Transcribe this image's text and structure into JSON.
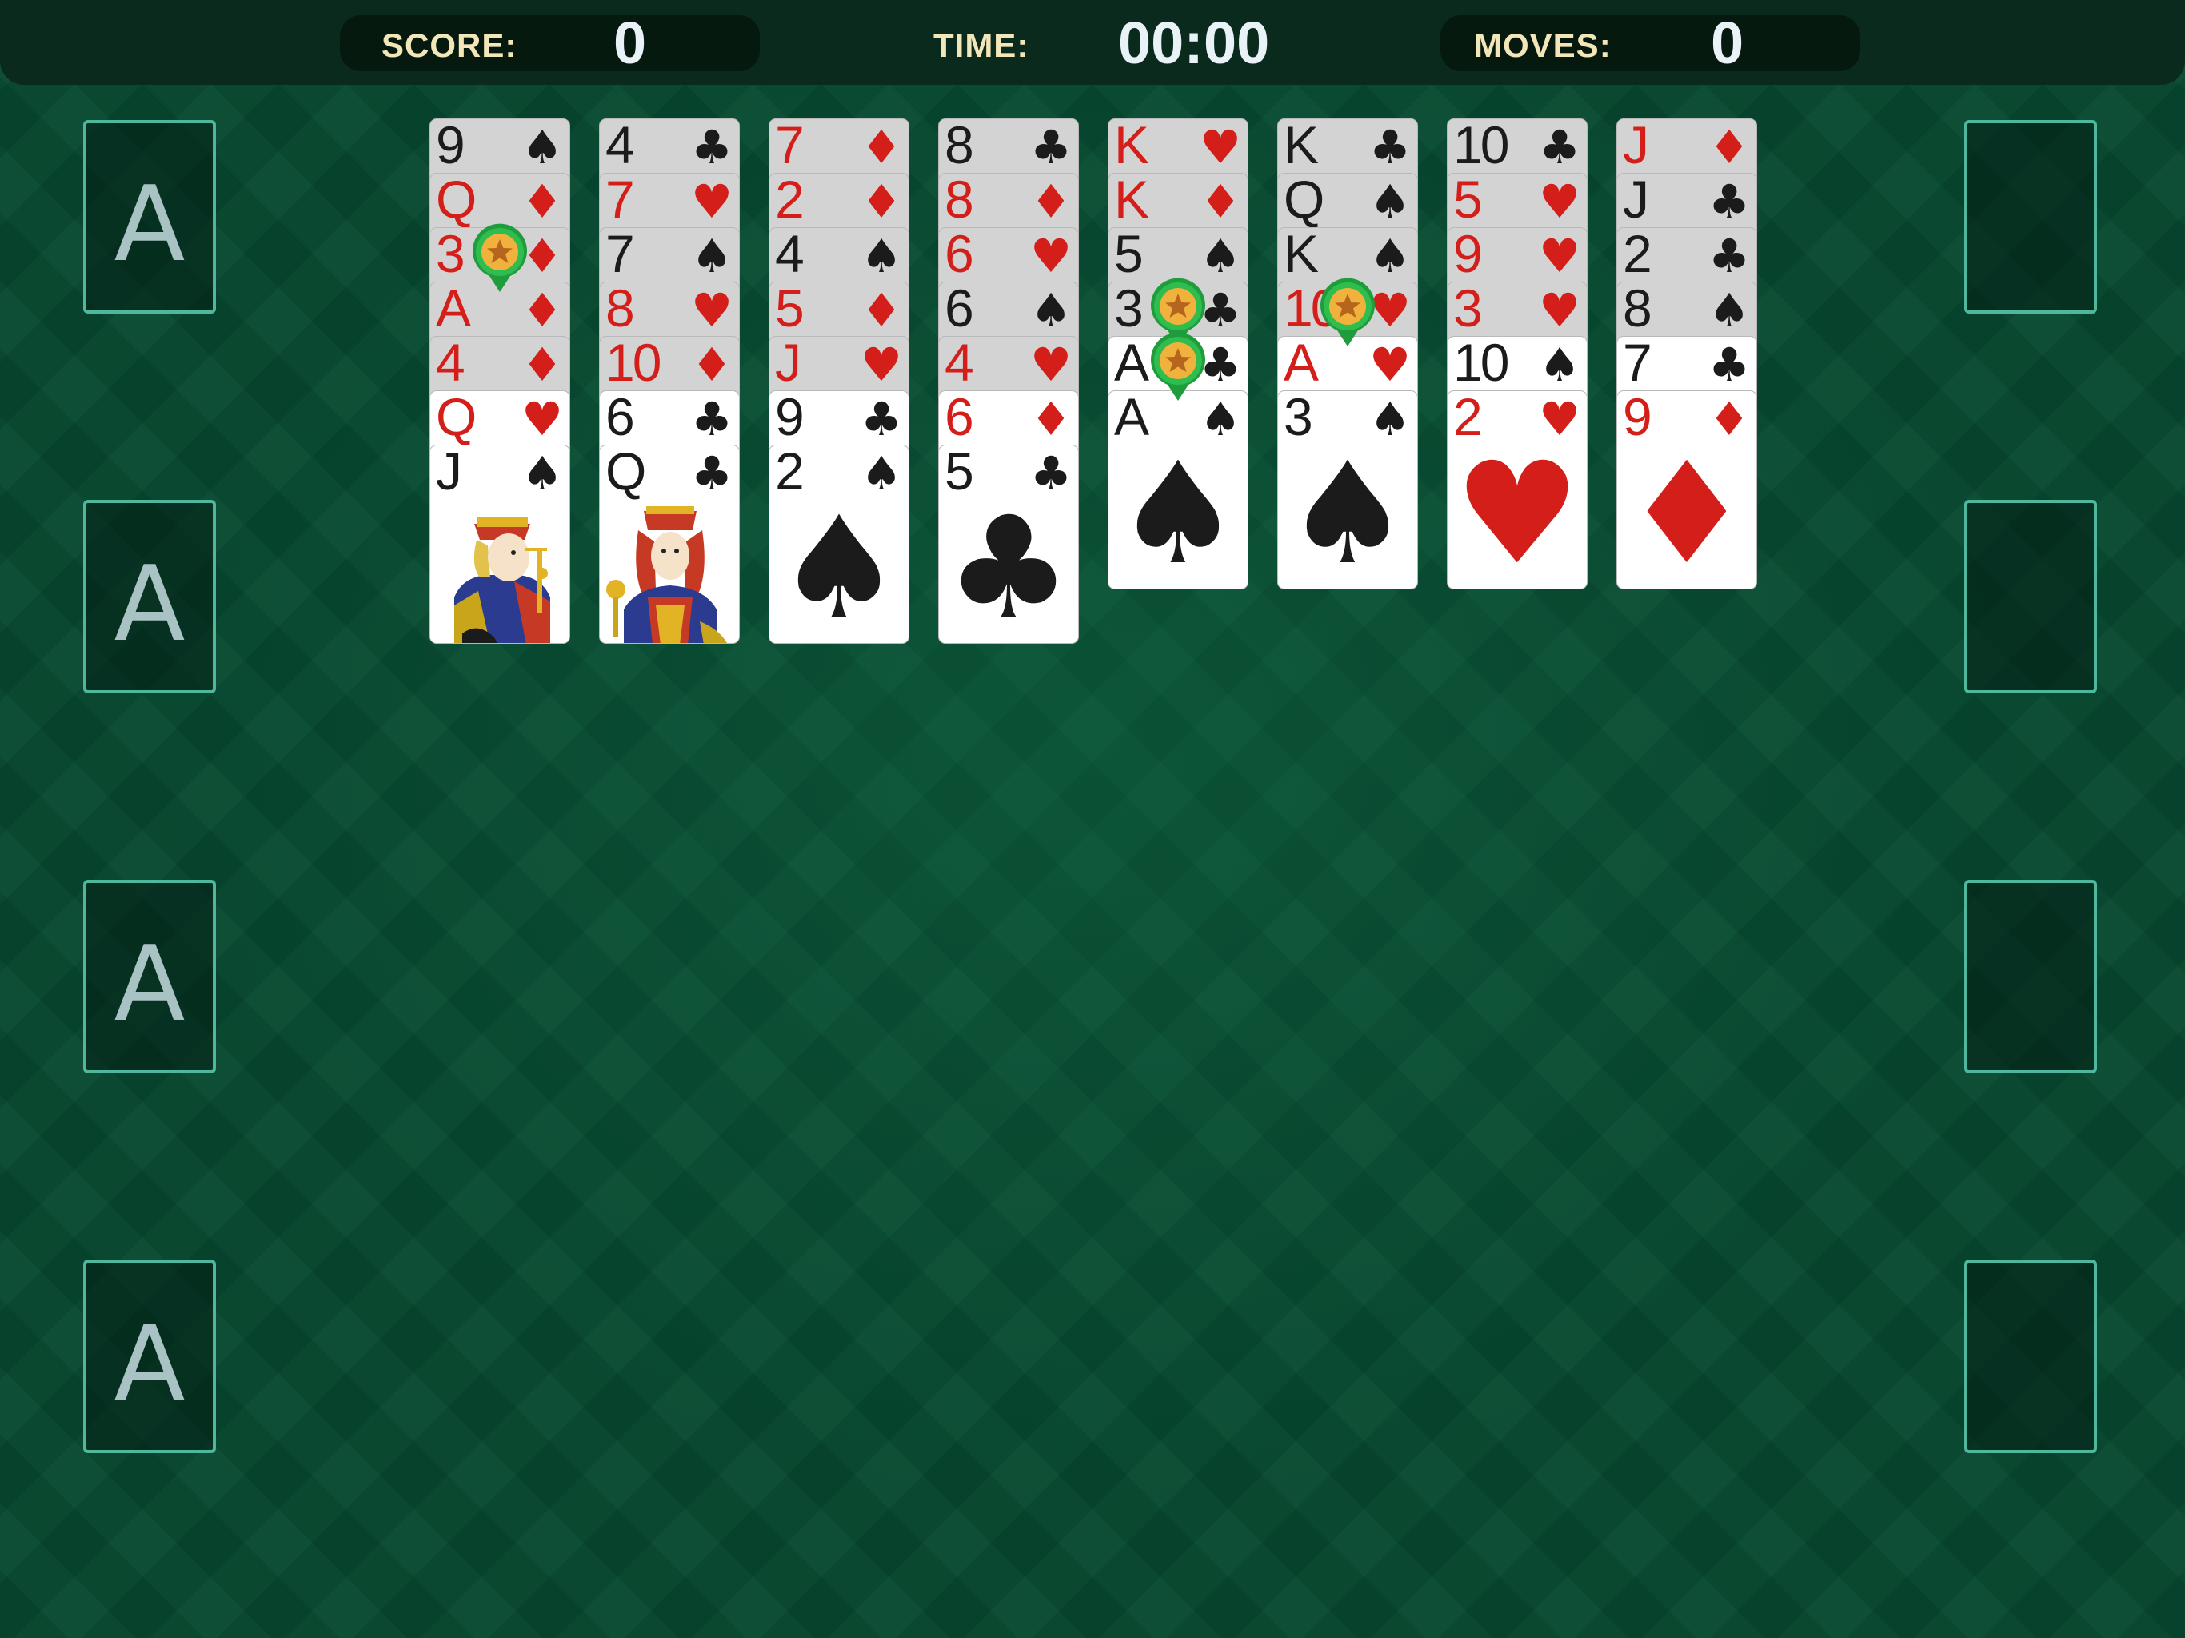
{
  "header": {
    "score_label": "SCORE:",
    "score_value": "0",
    "time_label": "TIME:",
    "time_value": "00:00",
    "moves_label": "MOVES:",
    "moves_value": "0"
  },
  "foundations": [
    {
      "label": "A"
    },
    {
      "label": "A"
    },
    {
      "label": "A"
    },
    {
      "label": "A"
    }
  ],
  "free_cells": [
    {
      "card": null
    },
    {
      "card": null
    },
    {
      "card": null
    },
    {
      "card": null
    }
  ],
  "colors": {
    "felt": "#064930",
    "header_bg": "#0b2a1e",
    "header_label": "#f3e6b8",
    "slot_border": "#4fb79c",
    "red_suit": "#d41e1a",
    "black_suit": "#1b1b1b",
    "badge_green": "#1f9d3c",
    "badge_gold": "#f0b23c"
  },
  "columns": [
    {
      "cards": [
        {
          "rank": "9",
          "suit": "♠",
          "color": "black"
        },
        {
          "rank": "Q",
          "suit": "♦",
          "color": "red"
        },
        {
          "rank": "3",
          "suit": "♦",
          "color": "red",
          "badge": "star-badge"
        },
        {
          "rank": "A",
          "suit": "♦",
          "color": "red"
        },
        {
          "rank": "4",
          "suit": "♦",
          "color": "red"
        },
        {
          "rank": "Q",
          "suit": "♥",
          "color": "red"
        },
        {
          "rank": "J",
          "suit": "♠",
          "color": "black",
          "face": "jack-portrait"
        }
      ]
    },
    {
      "cards": [
        {
          "rank": "4",
          "suit": "♣",
          "color": "black"
        },
        {
          "rank": "7",
          "suit": "♥",
          "color": "red"
        },
        {
          "rank": "7",
          "suit": "♠",
          "color": "black"
        },
        {
          "rank": "8",
          "suit": "♥",
          "color": "red"
        },
        {
          "rank": "10",
          "suit": "♦",
          "color": "red"
        },
        {
          "rank": "6",
          "suit": "♣",
          "color": "black"
        },
        {
          "rank": "Q",
          "suit": "♣",
          "color": "black",
          "face": "queen-portrait"
        }
      ]
    },
    {
      "cards": [
        {
          "rank": "7",
          "suit": "♦",
          "color": "red"
        },
        {
          "rank": "2",
          "suit": "♦",
          "color": "red"
        },
        {
          "rank": "4",
          "suit": "♠",
          "color": "black"
        },
        {
          "rank": "5",
          "suit": "♦",
          "color": "red"
        },
        {
          "rank": "J",
          "suit": "♥",
          "color": "red"
        },
        {
          "rank": "9",
          "suit": "♣",
          "color": "black"
        },
        {
          "rank": "2",
          "suit": "♠",
          "color": "black"
        }
      ]
    },
    {
      "cards": [
        {
          "rank": "8",
          "suit": "♣",
          "color": "black"
        },
        {
          "rank": "8",
          "suit": "♦",
          "color": "red"
        },
        {
          "rank": "6",
          "suit": "♥",
          "color": "red"
        },
        {
          "rank": "6",
          "suit": "♠",
          "color": "black"
        },
        {
          "rank": "4",
          "suit": "♥",
          "color": "red"
        },
        {
          "rank": "6",
          "suit": "♦",
          "color": "red"
        },
        {
          "rank": "5",
          "suit": "♣",
          "color": "black"
        }
      ]
    },
    {
      "cards": [
        {
          "rank": "K",
          "suit": "♥",
          "color": "red"
        },
        {
          "rank": "K",
          "suit": "♦",
          "color": "red"
        },
        {
          "rank": "5",
          "suit": "♠",
          "color": "black"
        },
        {
          "rank": "3",
          "suit": "♣",
          "color": "black",
          "badge": "star-badge"
        },
        {
          "rank": "A",
          "suit": "♣",
          "color": "black",
          "badge": "star-badge"
        },
        {
          "rank": "A",
          "suit": "♠",
          "color": "black"
        }
      ]
    },
    {
      "cards": [
        {
          "rank": "K",
          "suit": "♣",
          "color": "black"
        },
        {
          "rank": "Q",
          "suit": "♠",
          "color": "black"
        },
        {
          "rank": "K",
          "suit": "♠",
          "color": "black"
        },
        {
          "rank": "10",
          "suit": "♥",
          "color": "red",
          "badge": "star-badge"
        },
        {
          "rank": "A",
          "suit": "♥",
          "color": "red"
        },
        {
          "rank": "3",
          "suit": "♠",
          "color": "black"
        }
      ]
    },
    {
      "cards": [
        {
          "rank": "10",
          "suit": "♣",
          "color": "black"
        },
        {
          "rank": "5",
          "suit": "♥",
          "color": "red"
        },
        {
          "rank": "9",
          "suit": "♥",
          "color": "red"
        },
        {
          "rank": "3",
          "suit": "♥",
          "color": "red"
        },
        {
          "rank": "10",
          "suit": "♠",
          "color": "black"
        },
        {
          "rank": "2",
          "suit": "♥",
          "color": "red"
        }
      ]
    },
    {
      "cards": [
        {
          "rank": "J",
          "suit": "♦",
          "color": "red"
        },
        {
          "rank": "J",
          "suit": "♣",
          "color": "black"
        },
        {
          "rank": "2",
          "suit": "♣",
          "color": "black"
        },
        {
          "rank": "8",
          "suit": "♠",
          "color": "black"
        },
        {
          "rank": "7",
          "suit": "♣",
          "color": "black"
        },
        {
          "rank": "9",
          "suit": "♦",
          "color": "red"
        }
      ]
    }
  ]
}
